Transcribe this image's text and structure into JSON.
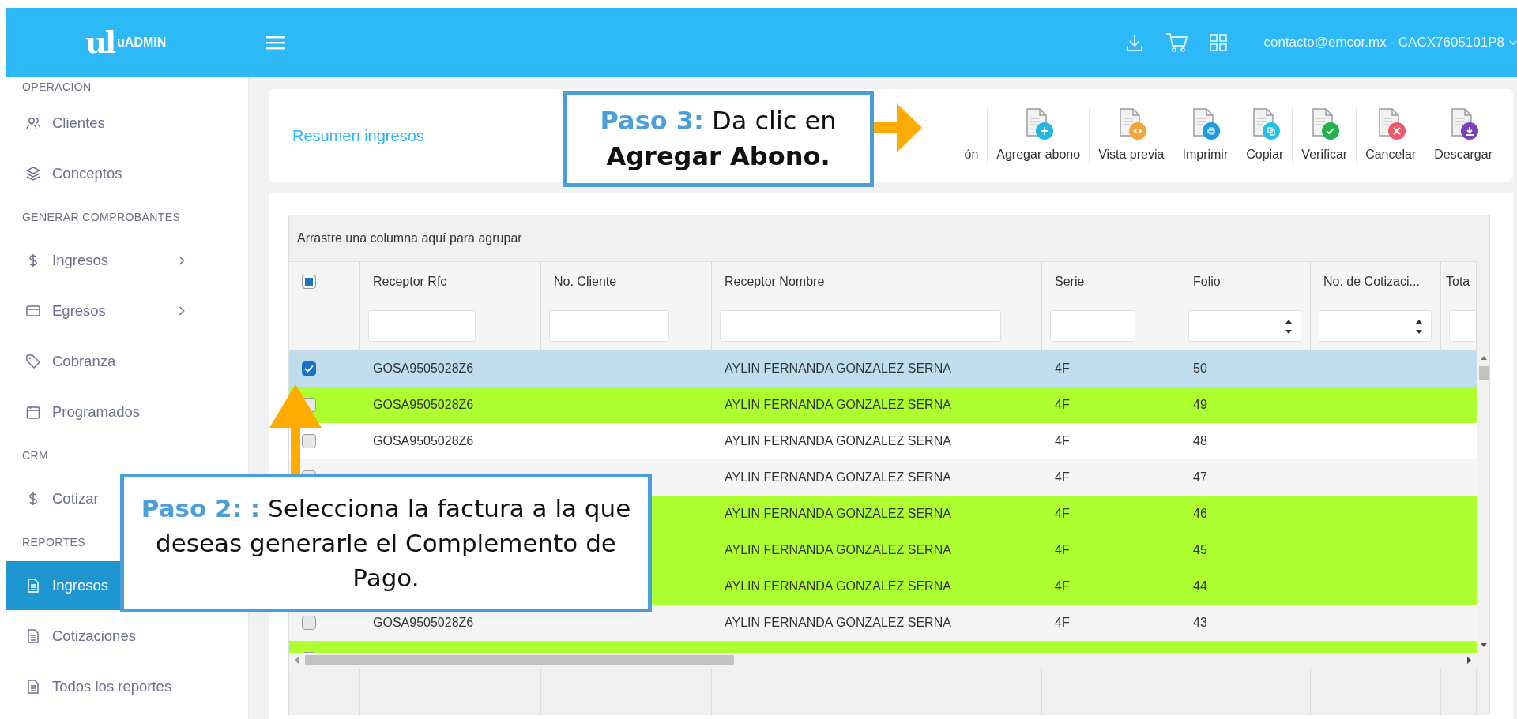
{
  "header": {
    "logo_mark": "ul",
    "logo_text": "uADMIN",
    "user": "contacto@emcor.mx - CACX7605101P8"
  },
  "sidebar": {
    "sections": [
      {
        "title": "OPERACIÓN",
        "items": [
          {
            "label": "Clientes",
            "expandable": false,
            "selected": false
          },
          {
            "label": "Conceptos",
            "expandable": false,
            "selected": false
          }
        ]
      },
      {
        "title": "GENERAR COMPROBANTES",
        "items": [
          {
            "label": "Ingresos",
            "expandable": true,
            "selected": false
          },
          {
            "label": "Egresos",
            "expandable": true,
            "selected": false
          },
          {
            "label": "Cobranza",
            "expandable": false,
            "selected": false
          },
          {
            "label": "Programados",
            "expandable": false,
            "selected": false
          }
        ]
      },
      {
        "title": "CRM",
        "items": [
          {
            "label": "Cotizar",
            "selected": false
          }
        ]
      },
      {
        "title": "REPORTES",
        "items": [
          {
            "label": "Ingresos",
            "expandable": false,
            "selected": true
          },
          {
            "label": "Cotizaciones",
            "expandable": false,
            "selected": false
          },
          {
            "label": "Todos los reportes",
            "expandable": false,
            "selected": false
          }
        ]
      }
    ]
  },
  "toolbar": {
    "title": "Resumen ingresos",
    "buttons": [
      {
        "label": "ón",
        "kind": "text"
      },
      {
        "label": "Agregar abono",
        "kind": "icon",
        "color": "#1fb7e6"
      },
      {
        "label": "Vista previa",
        "kind": "icon",
        "color": "#f4a43a"
      },
      {
        "label": "Imprimir",
        "kind": "icon",
        "color": "#1b9ae6"
      },
      {
        "label": "Copiar",
        "kind": "icon",
        "color": "#22c1e8"
      },
      {
        "label": "Verificar",
        "kind": "icon",
        "color": "#1fb24a"
      },
      {
        "label": "Cancelar",
        "kind": "icon",
        "color": "#f0576b"
      },
      {
        "label": "Descargar",
        "kind": "icon",
        "color": "#7b3fbf"
      }
    ]
  },
  "table": {
    "group_hint": "Arrastre una columna aquí para agrupar",
    "header_checkbox": {
      "indeterminate": true
    },
    "columns": [
      {
        "label": "Receptor Rfc",
        "kind": "text"
      },
      {
        "label": "No. Cliente",
        "kind": "text"
      },
      {
        "label": "Receptor Nombre",
        "kind": "text"
      },
      {
        "label": "Serie",
        "kind": "text"
      },
      {
        "label": "Folio",
        "kind": "number"
      },
      {
        "label": "No. de Cotizaci...",
        "kind": "number"
      },
      {
        "label": "Tota",
        "kind": "text"
      }
    ],
    "rows": [
      {
        "selected": true,
        "cells": [
          "GOSA9505028Z6",
          null,
          "AYLIN FERNANDA GONZALEZ SERNA",
          "4F",
          "50",
          null,
          null
        ]
      },
      {
        "selected": false,
        "color": "#adff2f",
        "cells": [
          "GOSA9505028Z6",
          null,
          "AYLIN FERNANDA GONZALEZ SERNA",
          "4F",
          "49",
          null,
          null
        ]
      },
      {
        "selected": false,
        "color": "#ffffff",
        "cells": [
          "GOSA9505028Z6",
          null,
          "AYLIN FERNANDA GONZALEZ SERNA",
          "4F",
          "48",
          null,
          null
        ]
      },
      {
        "selected": false,
        "color": "#f5f5f5",
        "cells": [
          null,
          null,
          "AYLIN FERNANDA GONZALEZ SERNA",
          "4F",
          "47",
          null,
          null
        ]
      },
      {
        "selected": false,
        "color": "#adff2f",
        "cells": [
          null,
          null,
          "AYLIN FERNANDA GONZALEZ SERNA",
          "4F",
          "46",
          null,
          null
        ]
      },
      {
        "selected": false,
        "color": "#adff2f",
        "cells": [
          null,
          null,
          "AYLIN FERNANDA GONZALEZ SERNA",
          "4F",
          "45",
          null,
          null
        ]
      },
      {
        "selected": false,
        "color": "#adff2f",
        "cells": [
          null,
          null,
          "AYLIN FERNANDA GONZALEZ SERNA",
          "4F",
          "44",
          null,
          null
        ]
      },
      {
        "selected": false,
        "color": "#f5f5f5",
        "cells": [
          "GOSA9505028Z6",
          null,
          "AYLIN FERNANDA GONZALEZ SERNA",
          "4F",
          "43",
          null,
          null
        ]
      },
      {
        "selected": false,
        "color": "#adff2f",
        "cells": [
          null,
          null,
          null,
          null,
          null,
          null,
          null
        ]
      }
    ]
  },
  "callouts": [
    {
      "text": "**Paso 3:** Da clic en **Agregar Abono.**"
    },
    {
      "text": "**Paso 2: :** Selecciona la factura a la que deseas generarle el Complemento de Pago."
    }
  ]
}
